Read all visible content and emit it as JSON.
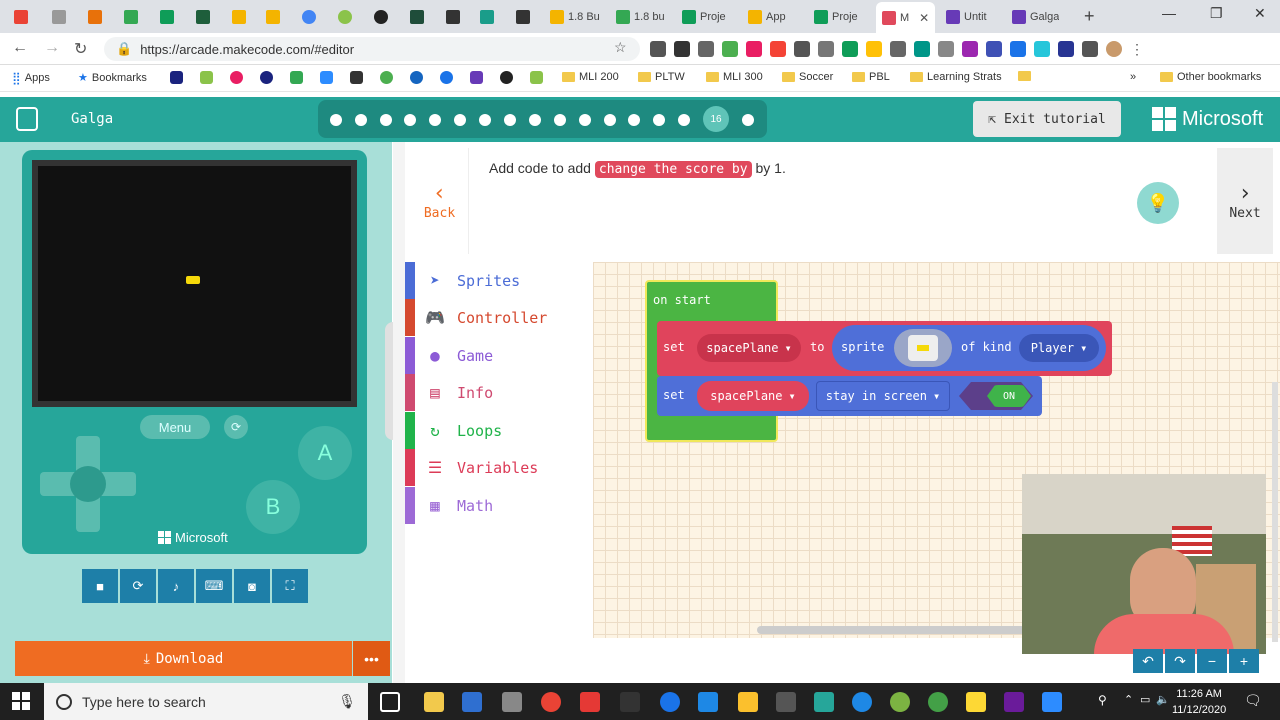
{
  "browser": {
    "tabs": [
      "1.8 Bu",
      "1.8 bu",
      "Proje",
      "App",
      "Proje",
      "M",
      "Untit",
      "Galga"
    ],
    "active_tab_label": "M",
    "url": "https://arcade.makecode.com/#editor"
  },
  "bookmarks": {
    "apps": "Apps",
    "bookmarks": "Bookmarks",
    "folders": [
      "MLI 200",
      "PLTW",
      "MLI 300",
      "Soccer",
      "PBL",
      "Learning Strats"
    ],
    "overflow": "»",
    "other": "Other bookmarks"
  },
  "header": {
    "project_name": "Galga",
    "current_step": "16",
    "exit_label": "Exit tutorial",
    "brand": "Microsoft"
  },
  "tutorial": {
    "back_label": "Back",
    "instruction_prefix": "Add code to add",
    "instruction_block": "change the score by",
    "instruction_suffix": "by 1.",
    "next_label": "Next"
  },
  "simulator": {
    "menu_label": "Menu",
    "a_label": "A",
    "b_label": "B",
    "brand": "Microsoft",
    "download_label": "Download",
    "more_label": "•••"
  },
  "toolbox": {
    "categories": [
      {
        "label": "Sprites",
        "color": "#4b6cd6"
      },
      {
        "label": "Controller",
        "color": "#d5492f"
      },
      {
        "label": "Game",
        "color": "#8c5bd6"
      },
      {
        "label": "Info",
        "color": "#cf4a70"
      },
      {
        "label": "Loops",
        "color": "#20b34a"
      },
      {
        "label": "Variables",
        "color": "#dc3b57"
      },
      {
        "label": "Math",
        "color": "#9d6ad6"
      }
    ]
  },
  "blocks": {
    "on_start": "on start",
    "b1_set": "set",
    "b1_var": "spacePlane",
    "b1_to": "to",
    "b1_sprite": "sprite",
    "b1_ofkind": "of kind",
    "b1_kind": "Player",
    "b2_set": "set",
    "b2_var": "spacePlane",
    "b2_prop": "stay in screen",
    "b2_toggle": "ON"
  },
  "taskbar": {
    "search_placeholder": "Type here to search",
    "time": "11:26 AM",
    "date": "11/12/2020"
  }
}
